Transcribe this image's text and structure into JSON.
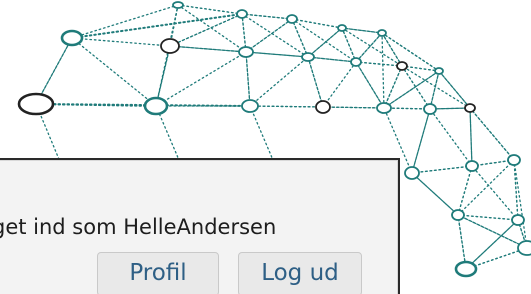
{
  "login": {
    "status_text": "get ind som HelleAndersen",
    "profile_label": "Profil",
    "logout_label": "Log ud"
  },
  "colors": {
    "accent": "#1f7b7a",
    "dark_node": "#222222",
    "panel_bg": "#f3f3f3",
    "button_text": "#2e5f85"
  },
  "icons": {
    "background": "network-globe-icon"
  }
}
